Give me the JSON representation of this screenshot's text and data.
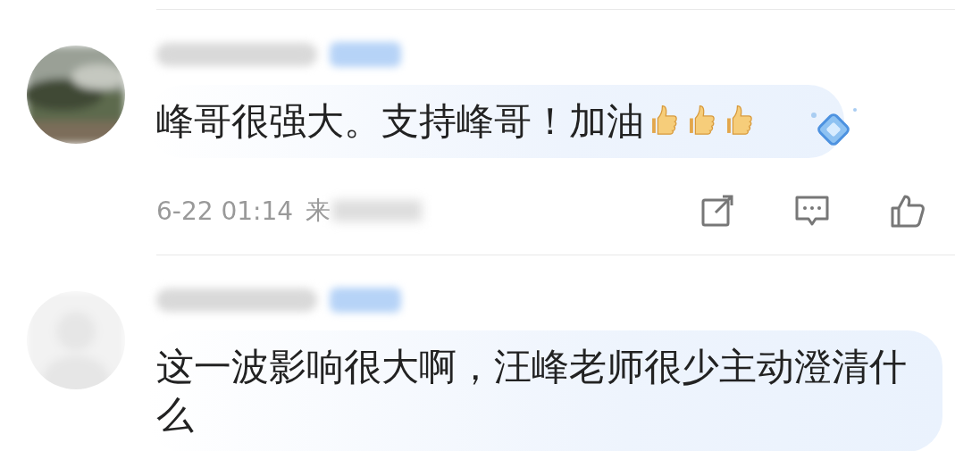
{
  "comments": [
    {
      "text": "峰哥很强大。支持峰哥！加油",
      "emojis": [
        {
          "kind": "thumbs-up"
        },
        {
          "kind": "thumbs-up"
        },
        {
          "kind": "thumbs-up"
        }
      ],
      "sticker": true,
      "time": "6-22 01:14",
      "source": "来",
      "actions": [
        {
          "kind": "share"
        },
        {
          "kind": "comment"
        },
        {
          "kind": "like"
        }
      ]
    },
    {
      "avatar": {
        "kind": "blank"
      },
      "text": "这一波影响很大啊，汪峰老师很少主动澄清什么"
    }
  ]
}
